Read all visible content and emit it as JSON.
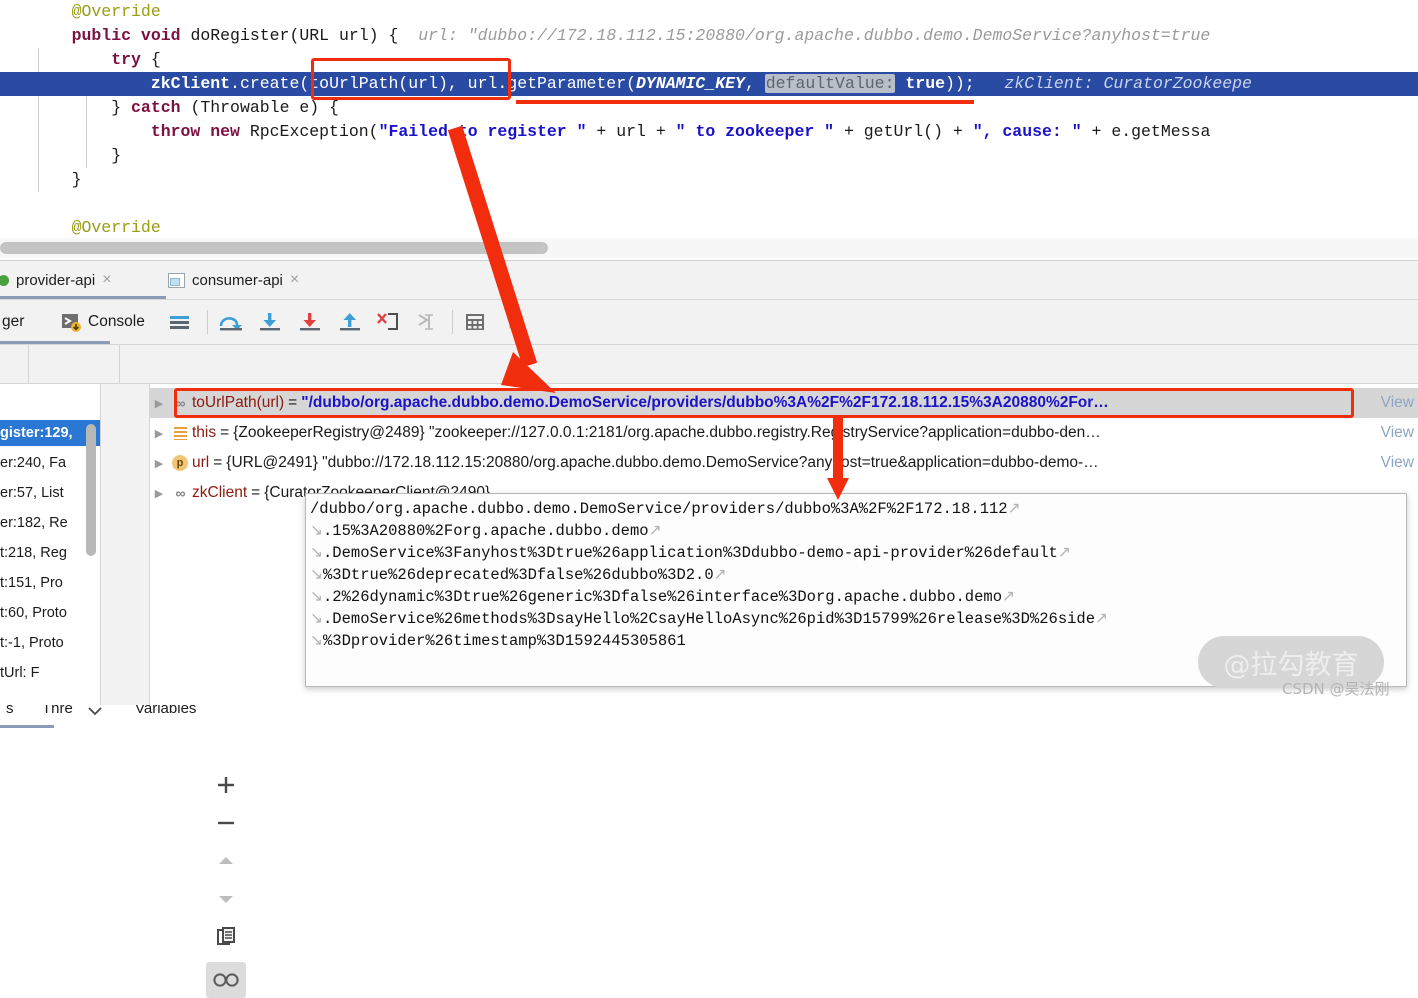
{
  "editor": {
    "lines": [
      {
        "indent": 0,
        "tokens": [
          {
            "c": "k-ann",
            "t": "    @Override"
          }
        ]
      },
      {
        "indent": 0,
        "tokens": [
          {
            "c": "k-kw",
            "t": "    public void "
          },
          {
            "c": "k-plain",
            "t": "doRegister(URL url) {  "
          },
          {
            "c": "k-hint",
            "t": "url: \"dubbo://172.18.112.15:20880/org.apache.dubbo.demo.DemoService?anyhost=true"
          }
        ]
      },
      {
        "indent": 0,
        "tokens": [
          {
            "c": "k-kw",
            "t": "        try "
          },
          {
            "c": "k-plain",
            "t": "{"
          }
        ]
      },
      {
        "indent": 0,
        "highlight": true,
        "tokens": [
          {
            "c": "k-whiteb",
            "t": "            zkClient"
          },
          {
            "c": "k-white",
            "t": ".create(toUrlPath(url), url.getParameter("
          },
          {
            "c": "k-whitei",
            "t": "DYNAMIC_KEY"
          },
          {
            "c": "k-white",
            "t": ", "
          },
          {
            "c": "k-param",
            "t": "defaultValue:"
          },
          {
            "c": "k-whiteb",
            "t": " true"
          },
          {
            "c": "k-white",
            "t": "));   "
          },
          {
            "c": "k-hint-w",
            "t": "zkClient: CuratorZookeepe"
          }
        ]
      },
      {
        "indent": 0,
        "tokens": [
          {
            "c": "k-plain",
            "t": "        } "
          },
          {
            "c": "k-kw",
            "t": "catch "
          },
          {
            "c": "k-plain",
            "t": "(Throwable e) {"
          }
        ]
      },
      {
        "indent": 0,
        "tokens": [
          {
            "c": "k-kw",
            "t": "            throw new "
          },
          {
            "c": "k-plain",
            "t": "RpcException("
          },
          {
            "c": "k-str",
            "t": "\"Failed to register \""
          },
          {
            "c": "k-plain",
            "t": " + url + "
          },
          {
            "c": "k-str",
            "t": "\" to zookeeper \""
          },
          {
            "c": "k-plain",
            "t": " + getUrl() + "
          },
          {
            "c": "k-str",
            "t": "\", cause: \""
          },
          {
            "c": "k-plain",
            "t": " + e.getMessa"
          }
        ]
      },
      {
        "indent": 0,
        "tokens": [
          {
            "c": "k-plain",
            "t": "        }"
          }
        ]
      },
      {
        "indent": 0,
        "tokens": [
          {
            "c": "k-plain",
            "t": "    }"
          }
        ]
      },
      {
        "indent": 0,
        "tokens": [
          {
            "c": "k-plain",
            "t": ""
          }
        ]
      },
      {
        "indent": 0,
        "tokens": [
          {
            "c": "k-ann",
            "t": "    @Override"
          }
        ]
      }
    ]
  },
  "tabs": [
    {
      "label": "provider-api",
      "icon": "green-dot-icon",
      "close": "×",
      "active": true
    },
    {
      "label": "consumer-api",
      "icon": "window-icon",
      "close": "×",
      "active": false
    }
  ],
  "debug_toolbar": {
    "debugger_label": "ger",
    "console_label": "Console",
    "icons": [
      {
        "name": "console-icon",
        "glyph": ""
      },
      {
        "name": "show-all-frames-icon",
        "glyph": ""
      },
      {
        "name": "step-over-icon",
        "glyph": ""
      },
      {
        "name": "step-into-icon",
        "glyph": ""
      },
      {
        "name": "force-step-into-icon",
        "glyph": ""
      },
      {
        "name": "step-out-icon",
        "glyph": ""
      },
      {
        "name": "drop-frame-icon",
        "glyph": ""
      },
      {
        "name": "run-to-cursor-icon",
        "glyph": ""
      },
      {
        "name": "evaluate-expression-icon",
        "glyph": ""
      },
      {
        "name": "settings-lines-icon",
        "glyph": ""
      }
    ]
  },
  "panel_header": {
    "frames_label": "s",
    "threads_label": "Thre",
    "threads_chevron": "⌵",
    "variables_label": "Variables"
  },
  "frames": {
    "toolbar_icons": [
      {
        "name": "move-up-icon"
      },
      {
        "name": "move-down-icon"
      },
      {
        "name": "filter-icon"
      }
    ],
    "rows": [
      {
        "text": "gister:129,",
        "selected": true
      },
      {
        "text": "er:240, Fa",
        "selected": false
      },
      {
        "text": "er:57, List",
        "selected": false
      },
      {
        "text": "er:182, Re",
        "selected": false
      },
      {
        "text": "t:218, Reg",
        "selected": false
      },
      {
        "text": "t:151, Pro",
        "selected": false
      },
      {
        "text": "t:60, Proto",
        "selected": false
      },
      {
        "text": "t:-1, Proto",
        "selected": false
      },
      {
        "text": "tUrl: F",
        "selected": false
      }
    ]
  },
  "vtool": {
    "buttons": [
      {
        "name": "add-watch-icon",
        "glyph": "+"
      },
      {
        "name": "remove-watch-icon",
        "glyph": "−"
      },
      {
        "name": "move-watch-up-icon",
        "glyph": "▲"
      },
      {
        "name": "move-watch-down-icon",
        "glyph": "▼"
      },
      {
        "name": "copy-value-icon",
        "glyph": ""
      },
      {
        "name": "inspect-icon",
        "glyph": "oo"
      }
    ]
  },
  "variables": {
    "view_label": "View",
    "rows": [
      {
        "icon": "watch-oo-icon",
        "name": "toUrlPath(url)",
        "eq": " = ",
        "value": "\"/dubbo/org.apache.dubbo.demo.DemoService/providers/dubbo%3A%2F%2F172.18.112.15%3A20880%2For…",
        "value_style": "blue",
        "selected": true,
        "has_view": true
      },
      {
        "icon": "object-lines-icon",
        "name": "this",
        "eq": " = ",
        "value": "{ZookeeperRegistry@2489} \"zookeeper://127.0.0.1:2181/org.apache.dubbo.registry.RegistryService?application=dubbo-den…",
        "value_style": "dark",
        "selected": false,
        "has_view": true
      },
      {
        "icon": "parameter-p-icon",
        "name": "url",
        "eq": " = ",
        "value": "{URL@2491} \"dubbo://172.18.112.15:20880/org.apache.dubbo.demo.DemoService?anyhost=true&application=dubbo-demo-…",
        "value_style": "dark",
        "selected": false,
        "has_view": true
      },
      {
        "icon": "watch-oo-icon",
        "name": "zkClient",
        "eq": " = ",
        "value": "{CuratorZookeeperClient@2490}",
        "value_style": "dark",
        "selected": false,
        "has_view": false
      }
    ]
  },
  "popup": {
    "lines": [
      {
        "arrow": false,
        "text": "/dubbo/org.apache.dubbo.demo.DemoService/providers/dubbo%3A%2F%2F172.18.112",
        "tail": true
      },
      {
        "arrow": true,
        "text": ".15%3A20880%2Forg.apache.dubbo.demo",
        "tail": true
      },
      {
        "arrow": true,
        "text": ".DemoService%3Fanyhost%3Dtrue%26application%3Ddubbo-demo-api-provider%26default",
        "tail": true
      },
      {
        "arrow": true,
        "text": "%3Dtrue%26deprecated%3Dfalse%26dubbo%3D2.0",
        "tail": true
      },
      {
        "arrow": true,
        "text": ".2%26dynamic%3Dtrue%26generic%3Dfalse%26interface%3Dorg.apache.dubbo.demo",
        "tail": true
      },
      {
        "arrow": true,
        "text": ".DemoService%26methods%3DsayHello%2CsayHelloAsync%26pid%3D15799%26release%3D%26side",
        "tail": true
      },
      {
        "arrow": true,
        "text": "%3Dprovider%26timestamp%3D1592445305861",
        "tail": false
      }
    ]
  },
  "watermarks": {
    "pill": "@拉勾教育",
    "csdn": "CSDN @吴法刚"
  },
  "colors": {
    "accent_red": "#f12d0e",
    "code_highlight": "#2a4ba3",
    "selection_blue": "#2b77d4",
    "string_blue": "#1a12c8"
  }
}
